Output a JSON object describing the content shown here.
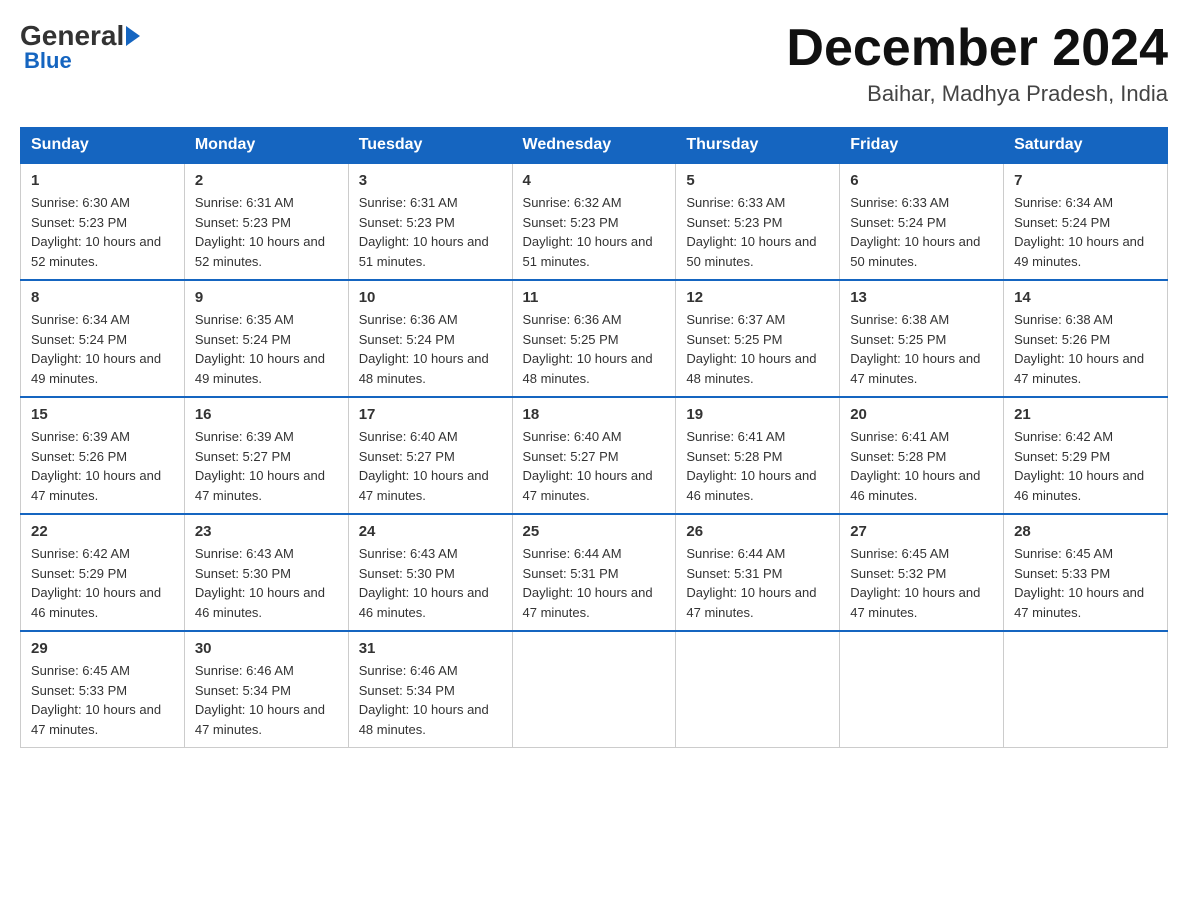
{
  "logo": {
    "general": "General",
    "blue": "Blue",
    "subtitle": "Blue"
  },
  "header": {
    "month": "December 2024",
    "location": "Baihar, Madhya Pradesh, India"
  },
  "weekdays": [
    "Sunday",
    "Monday",
    "Tuesday",
    "Wednesday",
    "Thursday",
    "Friday",
    "Saturday"
  ],
  "weeks": [
    [
      {
        "day": "1",
        "sunrise": "6:30 AM",
        "sunset": "5:23 PM",
        "daylight": "10 hours and 52 minutes."
      },
      {
        "day": "2",
        "sunrise": "6:31 AM",
        "sunset": "5:23 PM",
        "daylight": "10 hours and 52 minutes."
      },
      {
        "day": "3",
        "sunrise": "6:31 AM",
        "sunset": "5:23 PM",
        "daylight": "10 hours and 51 minutes."
      },
      {
        "day": "4",
        "sunrise": "6:32 AM",
        "sunset": "5:23 PM",
        "daylight": "10 hours and 51 minutes."
      },
      {
        "day": "5",
        "sunrise": "6:33 AM",
        "sunset": "5:23 PM",
        "daylight": "10 hours and 50 minutes."
      },
      {
        "day": "6",
        "sunrise": "6:33 AM",
        "sunset": "5:24 PM",
        "daylight": "10 hours and 50 minutes."
      },
      {
        "day": "7",
        "sunrise": "6:34 AM",
        "sunset": "5:24 PM",
        "daylight": "10 hours and 49 minutes."
      }
    ],
    [
      {
        "day": "8",
        "sunrise": "6:34 AM",
        "sunset": "5:24 PM",
        "daylight": "10 hours and 49 minutes."
      },
      {
        "day": "9",
        "sunrise": "6:35 AM",
        "sunset": "5:24 PM",
        "daylight": "10 hours and 49 minutes."
      },
      {
        "day": "10",
        "sunrise": "6:36 AM",
        "sunset": "5:24 PM",
        "daylight": "10 hours and 48 minutes."
      },
      {
        "day": "11",
        "sunrise": "6:36 AM",
        "sunset": "5:25 PM",
        "daylight": "10 hours and 48 minutes."
      },
      {
        "day": "12",
        "sunrise": "6:37 AM",
        "sunset": "5:25 PM",
        "daylight": "10 hours and 48 minutes."
      },
      {
        "day": "13",
        "sunrise": "6:38 AM",
        "sunset": "5:25 PM",
        "daylight": "10 hours and 47 minutes."
      },
      {
        "day": "14",
        "sunrise": "6:38 AM",
        "sunset": "5:26 PM",
        "daylight": "10 hours and 47 minutes."
      }
    ],
    [
      {
        "day": "15",
        "sunrise": "6:39 AM",
        "sunset": "5:26 PM",
        "daylight": "10 hours and 47 minutes."
      },
      {
        "day": "16",
        "sunrise": "6:39 AM",
        "sunset": "5:27 PM",
        "daylight": "10 hours and 47 minutes."
      },
      {
        "day": "17",
        "sunrise": "6:40 AM",
        "sunset": "5:27 PM",
        "daylight": "10 hours and 47 minutes."
      },
      {
        "day": "18",
        "sunrise": "6:40 AM",
        "sunset": "5:27 PM",
        "daylight": "10 hours and 47 minutes."
      },
      {
        "day": "19",
        "sunrise": "6:41 AM",
        "sunset": "5:28 PM",
        "daylight": "10 hours and 46 minutes."
      },
      {
        "day": "20",
        "sunrise": "6:41 AM",
        "sunset": "5:28 PM",
        "daylight": "10 hours and 46 minutes."
      },
      {
        "day": "21",
        "sunrise": "6:42 AM",
        "sunset": "5:29 PM",
        "daylight": "10 hours and 46 minutes."
      }
    ],
    [
      {
        "day": "22",
        "sunrise": "6:42 AM",
        "sunset": "5:29 PM",
        "daylight": "10 hours and 46 minutes."
      },
      {
        "day": "23",
        "sunrise": "6:43 AM",
        "sunset": "5:30 PM",
        "daylight": "10 hours and 46 minutes."
      },
      {
        "day": "24",
        "sunrise": "6:43 AM",
        "sunset": "5:30 PM",
        "daylight": "10 hours and 46 minutes."
      },
      {
        "day": "25",
        "sunrise": "6:44 AM",
        "sunset": "5:31 PM",
        "daylight": "10 hours and 47 minutes."
      },
      {
        "day": "26",
        "sunrise": "6:44 AM",
        "sunset": "5:31 PM",
        "daylight": "10 hours and 47 minutes."
      },
      {
        "day": "27",
        "sunrise": "6:45 AM",
        "sunset": "5:32 PM",
        "daylight": "10 hours and 47 minutes."
      },
      {
        "day": "28",
        "sunrise": "6:45 AM",
        "sunset": "5:33 PM",
        "daylight": "10 hours and 47 minutes."
      }
    ],
    [
      {
        "day": "29",
        "sunrise": "6:45 AM",
        "sunset": "5:33 PM",
        "daylight": "10 hours and 47 minutes."
      },
      {
        "day": "30",
        "sunrise": "6:46 AM",
        "sunset": "5:34 PM",
        "daylight": "10 hours and 47 minutes."
      },
      {
        "day": "31",
        "sunrise": "6:46 AM",
        "sunset": "5:34 PM",
        "daylight": "10 hours and 48 minutes."
      },
      null,
      null,
      null,
      null
    ]
  ]
}
